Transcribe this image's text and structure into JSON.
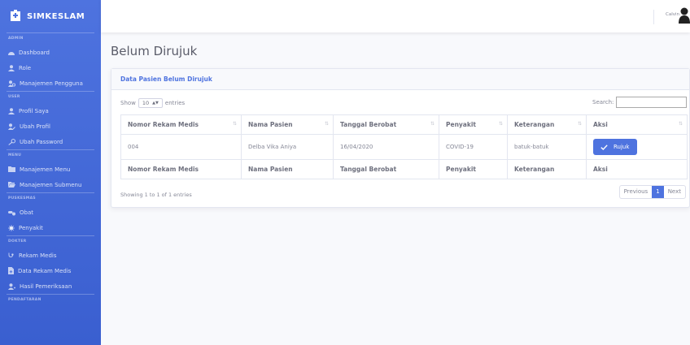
{
  "sidebar": {
    "brand": "SIMKESLAM",
    "sections": [
      {
        "heading": "ADMIN",
        "items": [
          {
            "label": "Dashboard",
            "icon": "dashboard-icon"
          },
          {
            "label": "Role",
            "icon": "user-icon"
          },
          {
            "label": "Manajemen Pengguna",
            "icon": "users-cog-icon"
          }
        ]
      },
      {
        "heading": "USER",
        "items": [
          {
            "label": "Profil Saya",
            "icon": "user-icon"
          },
          {
            "label": "Ubah Profil",
            "icon": "user-edit-icon"
          },
          {
            "label": "Ubah Password",
            "icon": "key-icon"
          }
        ]
      },
      {
        "heading": "MENU",
        "items": [
          {
            "label": "Manajemen Menu",
            "icon": "folder-icon"
          },
          {
            "label": "Manajemen Submenu",
            "icon": "folder-open-icon"
          }
        ]
      },
      {
        "heading": "PUSKESMAS",
        "items": [
          {
            "label": "Obat",
            "icon": "pills-icon"
          },
          {
            "label": "Penyakit",
            "icon": "virus-icon"
          }
        ]
      },
      {
        "heading": "DOKTER",
        "items": [
          {
            "label": "Rekam Medis",
            "icon": "stethoscope-icon"
          },
          {
            "label": "Data Rekam Medis",
            "icon": "file-medical-icon"
          },
          {
            "label": "Hasil Pemeriksaan",
            "icon": "user-md-icon"
          }
        ]
      },
      {
        "heading": "PENDAFTARAN",
        "items": []
      }
    ]
  },
  "topbar": {
    "user_name": "Calvin"
  },
  "page": {
    "title": "Belum Dirujuk"
  },
  "card": {
    "title": "Data Pasien Belum Dirujuk"
  },
  "controls": {
    "show_label": "Show",
    "entries_value": "10",
    "entries_label": "entries",
    "search_label": "Search:"
  },
  "table": {
    "columns": [
      "Nomor Rekam Medis",
      "Nama Pasien",
      "Tanggal Berobat",
      "Penyakit",
      "Keterangan",
      "Aksi"
    ],
    "rows": [
      {
        "nomor": "004",
        "nama": "Delba Vika Aniya",
        "tanggal": "16/04/2020",
        "penyakit": "COVID-19",
        "keterangan": "batuk-batuk",
        "aksi": "Rujuk"
      }
    ]
  },
  "footer": {
    "info": "Showing 1 to 1 of 1 entries",
    "previous": "Previous",
    "page": "1",
    "next": "Next"
  },
  "colors": {
    "primary": "#4e73df",
    "page_bg": "#f8f9fc"
  }
}
